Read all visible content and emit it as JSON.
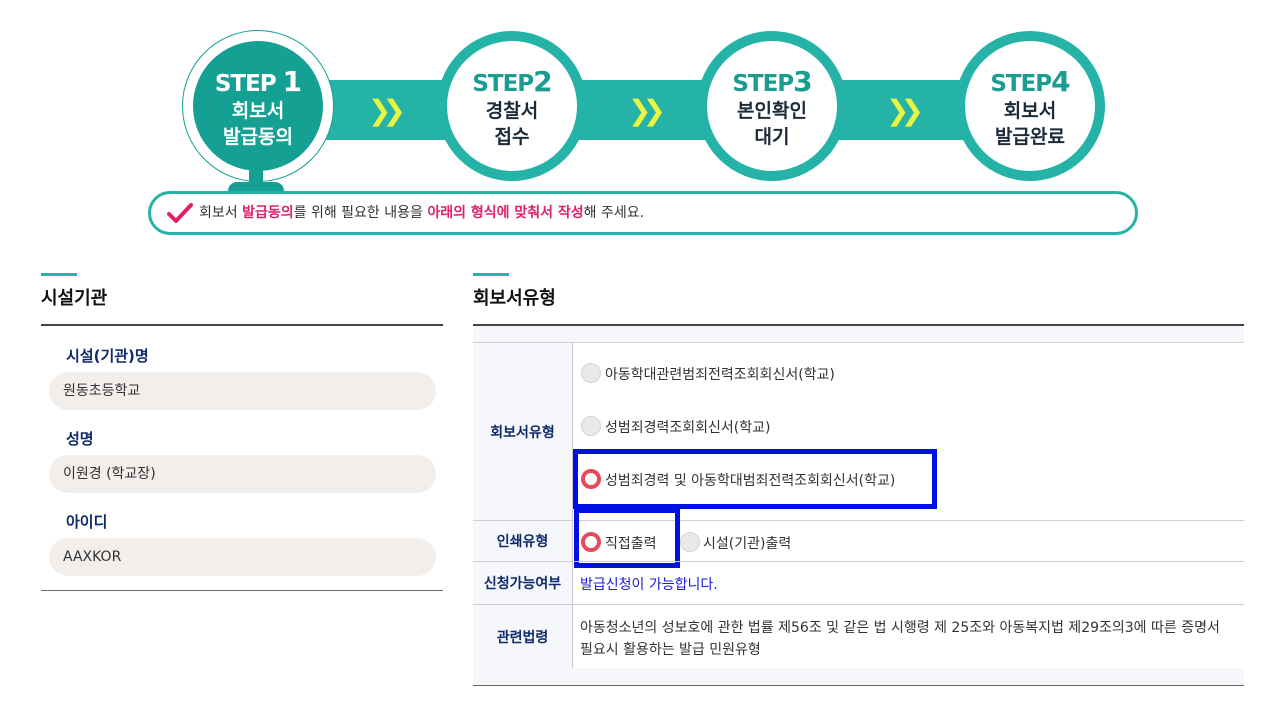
{
  "steps": [
    {
      "label": "STEP",
      "num": "1",
      "line1": "회보서",
      "line2": "발급동의",
      "active": true
    },
    {
      "label": "STEP",
      "num": "2",
      "line1": "경찰서",
      "line2": "접수",
      "active": false
    },
    {
      "label": "STEP",
      "num": "3",
      "line1": "본인확인",
      "line2": "대기",
      "active": false
    },
    {
      "label": "STEP",
      "num": "4",
      "line1": "회보서",
      "line2": "발급완료",
      "active": false
    }
  ],
  "notice": {
    "p1": "회보서 ",
    "h1": "발급동의",
    "p2": "를 위해 필요한 내용을 ",
    "h2": "아래의 형식에 맞춰서 작성",
    "p3": "해 주세요."
  },
  "facility": {
    "title": "시설기관",
    "fields": [
      {
        "label": "시설(기관)명",
        "value": "원동초등학교"
      },
      {
        "label": "성명",
        "value": "이원경 (학교장)"
      },
      {
        "label": "아이디",
        "value": "AAXKOR"
      }
    ]
  },
  "report": {
    "title": "회보서유형",
    "type_header": "회보서유형",
    "type_options": [
      {
        "label": "아동학대관련범죄전력조회회신서(학교)",
        "selected": false
      },
      {
        "label": "성범죄경력조회회신서(학교)",
        "selected": false
      },
      {
        "label": "성범죄경력 및 아동학대범죄전력조회회신서(학교)",
        "selected": true
      }
    ],
    "print_header": "인쇄유형",
    "print_options": [
      {
        "label": "직접출력",
        "selected": true
      },
      {
        "label": "시설(기관)출력",
        "selected": false
      }
    ],
    "avail_header": "신청가능여부",
    "avail_text": "발급신청이 가능합니다.",
    "law_header": "관련법령",
    "law_text": "아동청소년의 성보호에 관한 법률 제56조 및 같은 법 시행령 제 25조와 아동복지법 제29조의3에 따른 증명서 필요시 활용하는 발급 민원유형"
  },
  "colors": {
    "accent": "#26b3a7",
    "active_step": "#15a094",
    "highlight": "#e0206b",
    "box": "#0010e0",
    "link": "#1a1ad6"
  }
}
